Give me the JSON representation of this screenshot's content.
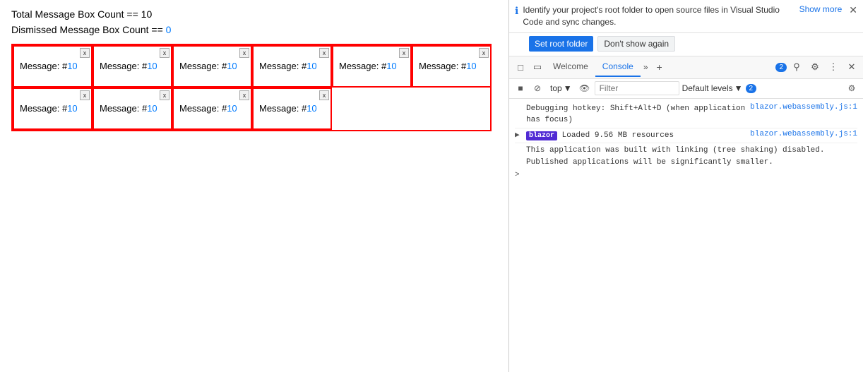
{
  "left": {
    "total_label": "Total Message Box Count == 10",
    "dismissed_label": "Dismissed Message Box Count == ",
    "dismissed_value": "0",
    "row1": [
      {
        "text": "Message: #",
        "num": "10"
      },
      {
        "text": "Message: #",
        "num": "10"
      },
      {
        "text": "Message: #",
        "num": "10"
      },
      {
        "text": "Message: #",
        "num": "10"
      },
      {
        "text": "Message: #",
        "num": "10"
      },
      {
        "text": "Message: #",
        "num": "10"
      }
    ],
    "row2": [
      {
        "text": "Message: #",
        "num": "10"
      },
      {
        "text": "Message: #",
        "num": "10"
      },
      {
        "text": "Message: #",
        "num": "10"
      },
      {
        "text": "Message: #",
        "num": "10"
      }
    ],
    "close_label": "x"
  },
  "devtools": {
    "notif_text": "Identify your project's root folder to open source files in Visual Studio Code and sync changes.",
    "show_more": "Show more",
    "btn_root": "Set root folder",
    "btn_dont_show": "Don't show again",
    "tabs": [
      "Welcome",
      "Console"
    ],
    "active_tab": "Console",
    "badge_count": "2",
    "filter_placeholder": "Filter",
    "levels_label": "Default levels",
    "levels_badge": "2",
    "console_lines": [
      {
        "text": "Debugging hotkey: Shift+Alt+D (when application has focus)",
        "link": "blazor.webassembly.js:1"
      },
      {
        "blazor": true,
        "text": " Loaded 9.56 MB resources",
        "link": "blazor.webassembly.js:1",
        "extra": "This application was built with linking (tree shaking) disabled.\nPublished applications will be significantly smaller."
      }
    ]
  }
}
